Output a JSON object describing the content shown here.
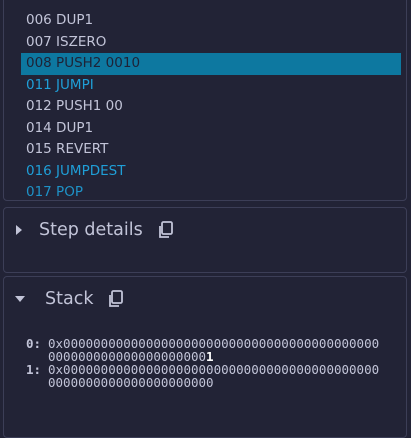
{
  "opcodes": {
    "items": [
      {
        "label": "006 DUP1",
        "style": "normal"
      },
      {
        "label": "007 ISZERO",
        "style": "normal"
      },
      {
        "label": "008 PUSH2 0010",
        "style": "selected"
      },
      {
        "label": "011 JUMPI",
        "style": "blue"
      },
      {
        "label": "012 PUSH1 00",
        "style": "normal"
      },
      {
        "label": "014 DUP1",
        "style": "normal"
      },
      {
        "label": "015 REVERT",
        "style": "normal"
      },
      {
        "label": "016 JUMPDEST",
        "style": "blue"
      },
      {
        "label": "017 POP",
        "style": "blue"
      }
    ]
  },
  "step_details": {
    "title": "Step details",
    "expanded": false,
    "icon": "copy-icon"
  },
  "stack": {
    "title": "Stack",
    "expanded": true,
    "icon": "copy-icon",
    "entries": [
      {
        "index": "0:",
        "value_main": "0x000000000000000000000000000000000000000000000000000000000000000",
        "value_tail": "1"
      },
      {
        "index": "1:",
        "value_main": "0x0000000000000000000000000000000000000000000000000000000000000000",
        "value_tail": ""
      }
    ]
  },
  "colors": {
    "background": "#222336",
    "border": "#3c3e57",
    "text": "#c2c4d8",
    "accent_blue": "#1f9fd8",
    "selected_bg": "#0d78a0"
  }
}
